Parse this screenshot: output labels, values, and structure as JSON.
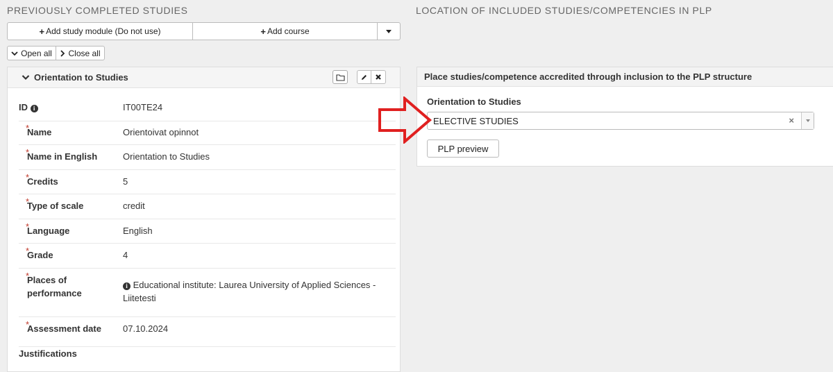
{
  "left": {
    "section_title": "PREVIOUSLY COMPLETED STUDIES",
    "add_module_label": "Add study module (Do not use)",
    "add_course_label": "Add course",
    "open_all_label": "Open all",
    "close_all_label": "Close all",
    "panel_title": "Orientation to Studies",
    "fields": {
      "id": {
        "label": "ID",
        "value": "IT00TE24"
      },
      "name": {
        "label": "Name",
        "value": "Orientoivat opinnot"
      },
      "name_en": {
        "label": "Name in English",
        "value": "Orientation to Studies"
      },
      "credits": {
        "label": "Credits",
        "value": "5"
      },
      "scale": {
        "label": "Type of scale",
        "value": "credit"
      },
      "language": {
        "label": "Language",
        "value": "English"
      },
      "grade": {
        "label": "Grade",
        "value": "4"
      },
      "places": {
        "label_line1": "Places of",
        "label_line2": "performance",
        "value_line1": "Educational institute: Laurea University of Applied Sciences -",
        "value_line2": "Liitetesti"
      },
      "assessment": {
        "label": "Assessment date",
        "value": "07.10.2024"
      },
      "justifications": {
        "label": "Justifications"
      }
    }
  },
  "right": {
    "section_title": "LOCATION OF INCLUDED STUDIES/COMPETENCIES IN PLP",
    "panel_title": "Place studies/competence accredited through inclusion to the PLP structure",
    "select_label": "Orientation to Studies",
    "select_value": "ELECTIVE STUDIES",
    "plp_preview_label": "PLP preview"
  },
  "colors": {
    "arrow": "#e02020",
    "required": "#c0392b"
  }
}
